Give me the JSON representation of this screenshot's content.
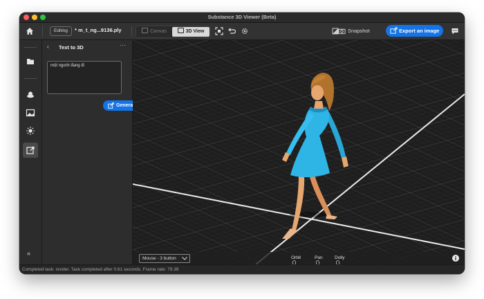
{
  "window": {
    "title": "Substance 3D Viewer (Beta)"
  },
  "toolbar": {
    "editing_label": "Editing",
    "filename": "* m_t_ng...9136.ply",
    "canvas_tab": "Canvas",
    "view3d_tab": "3D View",
    "snapshot_label": "Snapshot",
    "export_label": "Export an image"
  },
  "panel": {
    "title": "Text to 3D",
    "prompt_value": "một người đang đi",
    "generate_label": "Generate"
  },
  "viewport": {
    "mouse_mode": "Mouse - 3 button",
    "hints": [
      "Orbit",
      "Pan",
      "Dolly"
    ]
  },
  "status": {
    "text": "Completed task: render. Task completed after 0.61 seconds. Frame rate: 79.39"
  },
  "colors": {
    "accent": "#1473e6",
    "dress": "#2fb4e6",
    "skin": "#e7a66e",
    "hair": "#b0722c"
  },
  "icons": {
    "home": "home-icon",
    "sidebar": [
      "folder-icon",
      "cube-icon",
      "image-icon",
      "sun-icon",
      "text-to-3d-icon"
    ],
    "toolbar": [
      "frame-icon",
      "reset-icon",
      "settings-icon",
      "compare-icon",
      "camera-icon",
      "comment-icon"
    ]
  }
}
